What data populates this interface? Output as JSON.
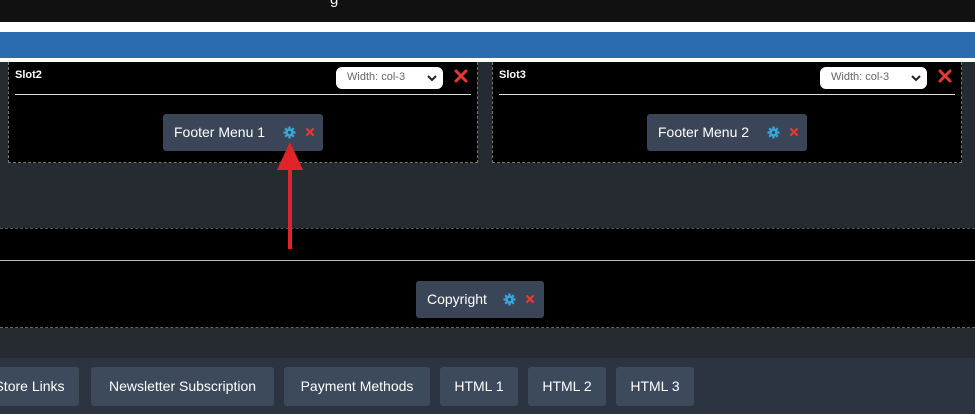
{
  "top_banner": {
    "partial_text": "g",
    "partial_link": ""
  },
  "slots": [
    {
      "title": "Slot2",
      "width_value": "Width: col-3",
      "widget": {
        "label": "Footer Menu 1"
      }
    },
    {
      "title": "Slot3",
      "width_value": "Width: col-3",
      "widget": {
        "label": "Footer Menu 2"
      }
    }
  ],
  "copyright_widget": {
    "label": "Copyright"
  },
  "widget_tabs": [
    {
      "label": "Store Links"
    },
    {
      "label": "Newsletter Subscription"
    },
    {
      "label": "Payment Methods"
    },
    {
      "label": "HTML 1"
    },
    {
      "label": "HTML 2"
    },
    {
      "label": "HTML 3"
    }
  ],
  "colors": {
    "accent_blue": "#2b6cb0",
    "delete_red": "#e53935",
    "gear_blue": "#3aa6d8",
    "annotation_arrow": "#e0242a"
  },
  "icons": {
    "settings": "gear-icon",
    "delete": "close-icon",
    "dropdown": "chevron-down-icon",
    "annotation": "red-arrow-icon"
  }
}
